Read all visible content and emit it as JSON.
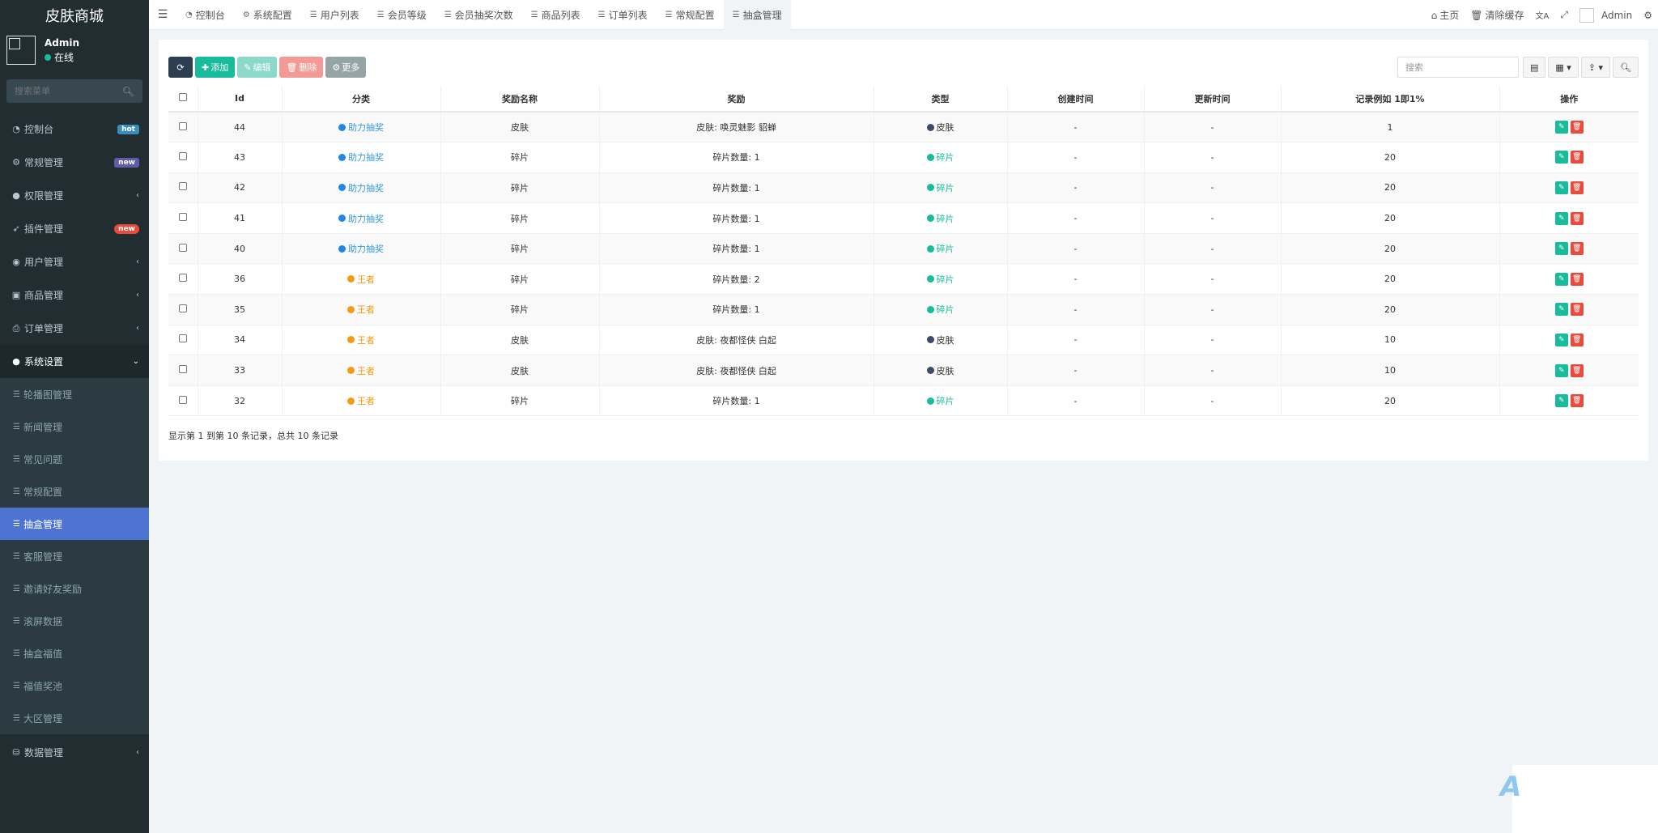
{
  "app": {
    "title": "皮肤商城"
  },
  "user": {
    "name": "Admin",
    "status": "在线"
  },
  "sidebar": {
    "search_placeholder": "搜索菜单",
    "items": [
      {
        "label": "控制台",
        "icon": "dashboard-icon",
        "badge": "hot"
      },
      {
        "label": "常规管理",
        "icon": "cogs-icon",
        "badge": "new"
      },
      {
        "label": "权限管理",
        "icon": "group-icon"
      },
      {
        "label": "插件管理",
        "icon": "rocket-icon",
        "badge": "new"
      },
      {
        "label": "用户管理",
        "icon": "user-icon"
      },
      {
        "label": "商品管理",
        "icon": "briefcase-icon"
      },
      {
        "label": "订单管理",
        "icon": "print-icon"
      },
      {
        "label": "系统设置",
        "icon": "circle-icon"
      }
    ],
    "submenu": [
      "轮播图管理",
      "新闻管理",
      "常见问题",
      "常规配置",
      "抽盒管理",
      "客服管理",
      "邀请好友奖励",
      "滚屏数据",
      "抽盒福值",
      "福值奖池",
      "大区管理"
    ],
    "last_item": {
      "label": "数据管理",
      "icon": "database-icon"
    }
  },
  "tabs": [
    "控制台",
    "系统配置",
    "用户列表",
    "会员等级",
    "会员抽奖次数",
    "商品列表",
    "订单列表",
    "常规配置",
    "抽盒管理"
  ],
  "topright": {
    "home": "主页",
    "clear_cache": "清除缓存",
    "user": "Admin"
  },
  "toolbar": {
    "add": "添加",
    "edit": "编辑",
    "delete": "删除",
    "more": "更多",
    "search_placeholder": "搜索"
  },
  "table": {
    "headers": [
      "Id",
      "分类",
      "奖励名称",
      "奖励",
      "类型",
      "创建时间",
      "更新时间",
      "记录例如 1即1%",
      "操作"
    ],
    "rows": [
      {
        "id": "44",
        "category": "助力抽奖",
        "name": "皮肤",
        "reward": "皮肤: 唤灵魅影 貂蝉",
        "type": "皮肤",
        "created": "-",
        "updated": "-",
        "rate": "1"
      },
      {
        "id": "43",
        "category": "助力抽奖",
        "name": "碎片",
        "reward": "碎片数量: 1",
        "type": "碎片",
        "created": "-",
        "updated": "-",
        "rate": "20"
      },
      {
        "id": "42",
        "category": "助力抽奖",
        "name": "碎片",
        "reward": "碎片数量: 1",
        "type": "碎片",
        "created": "-",
        "updated": "-",
        "rate": "20"
      },
      {
        "id": "41",
        "category": "助力抽奖",
        "name": "碎片",
        "reward": "碎片数量: 1",
        "type": "碎片",
        "created": "-",
        "updated": "-",
        "rate": "20"
      },
      {
        "id": "40",
        "category": "助力抽奖",
        "name": "碎片",
        "reward": "碎片数量: 1",
        "type": "碎片",
        "created": "-",
        "updated": "-",
        "rate": "20"
      },
      {
        "id": "36",
        "category": "王者",
        "name": "碎片",
        "reward": "碎片数量: 2",
        "type": "碎片",
        "created": "-",
        "updated": "-",
        "rate": "20"
      },
      {
        "id": "35",
        "category": "王者",
        "name": "碎片",
        "reward": "碎片数量: 1",
        "type": "碎片",
        "created": "-",
        "updated": "-",
        "rate": "20"
      },
      {
        "id": "34",
        "category": "王者",
        "name": "皮肤",
        "reward": "皮肤: 夜都怪侠 白起",
        "type": "皮肤",
        "created": "-",
        "updated": "-",
        "rate": "10"
      },
      {
        "id": "33",
        "category": "王者",
        "name": "皮肤",
        "reward": "皮肤: 夜都怪侠 白起",
        "type": "皮肤",
        "created": "-",
        "updated": "-",
        "rate": "10"
      },
      {
        "id": "32",
        "category": "王者",
        "name": "碎片",
        "reward": "碎片数量: 1",
        "type": "碎片",
        "created": "-",
        "updated": "-",
        "rate": "20"
      }
    ]
  },
  "footer": "显示第 1 到第 10 条记录，总共 10 条记录",
  "colors": {
    "sidebar_bg": "#222d32",
    "active": "#4f73d1",
    "success": "#18bc9c",
    "danger": "#e74c3c"
  }
}
